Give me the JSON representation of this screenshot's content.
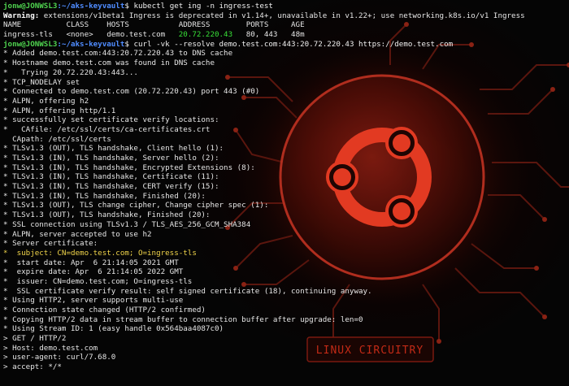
{
  "background": {
    "badge_text": "LINUX CIRCUITRY",
    "accent_color": "#ff3b1f"
  },
  "lines": [
    {
      "prompt": {
        "user": "jonw@JONWSL3",
        "path": ":~/aks-keyvault",
        "sym": "$ "
      },
      "text": "kubectl get ing -n ingress-test"
    },
    {
      "warn": "Warning:",
      "text": " extensions/v1beta1 Ingress is deprecated in v1.14+, unavailable in v1.22+; use networking.k8s.io/v1 Ingress"
    },
    {
      "text": "NAME          CLASS    HOSTS           ADDRESS        PORTS     AGE"
    },
    {
      "text": "ingress-tls   <none>   demo.test.com   ",
      "hl": "20.72.220.43",
      "rest": "   80, 443   48m"
    },
    {
      "prompt": {
        "user": "jonw@JONWSL3",
        "path": ":~/aks-keyvault",
        "sym": "$ "
      },
      "text": "curl -vk --resolve demo.test.com:443:20.72.220.43 https://demo.test.com"
    },
    {
      "text": "* Added demo.test.com:443:20.72.220.43 to DNS cache"
    },
    {
      "text": "* Hostname demo.test.com was found in DNS cache"
    },
    {
      "text": "*   Trying 20.72.220.43:443..."
    },
    {
      "text": "* TCP_NODELAY set"
    },
    {
      "text": "* Connected to demo.test.com (20.72.220.43) port 443 (#0)"
    },
    {
      "text": "* ALPN, offering h2"
    },
    {
      "text": "* ALPN, offering http/1.1"
    },
    {
      "text": "* successfully set certificate verify locations:"
    },
    {
      "text": "*   CAfile: /etc/ssl/certs/ca-certificates.crt"
    },
    {
      "text": "  CApath: /etc/ssl/certs"
    },
    {
      "text": "* TLSv1.3 (OUT), TLS handshake, Client hello (1):"
    },
    {
      "text": "* TLSv1.3 (IN), TLS handshake, Server hello (2):"
    },
    {
      "text": "* TLSv1.3 (IN), TLS handshake, Encrypted Extensions (8):"
    },
    {
      "text": "* TLSv1.3 (IN), TLS handshake, Certificate (11):"
    },
    {
      "text": "* TLSv1.3 (IN), TLS handshake, CERT verify (15):"
    },
    {
      "text": "* TLSv1.3 (IN), TLS handshake, Finished (20):"
    },
    {
      "text": "* TLSv1.3 (OUT), TLS change cipher, Change cipher spec (1):"
    },
    {
      "text": "* TLSv1.3 (OUT), TLS handshake, Finished (20):"
    },
    {
      "text": "* SSL connection using TLSv1.3 / TLS_AES_256_GCM_SHA384"
    },
    {
      "text": "* ALPN, server accepted to use h2"
    },
    {
      "text": "* Server certificate:"
    },
    {
      "text": "*  subject: CN=demo.test.com; O=ingress-tls",
      "color": "yellow"
    },
    {
      "text": "*  start date: Apr  6 21:14:05 2021 GMT"
    },
    {
      "text": "*  expire date: Apr  6 21:14:05 2022 GMT"
    },
    {
      "text": "*  issuer: CN=demo.test.com; O=ingress-tls"
    },
    {
      "text": "*  SSL certificate verify result: self signed certificate (18), continuing anyway."
    },
    {
      "text": "* Using HTTP2, server supports multi-use"
    },
    {
      "text": "* Connection state changed (HTTP/2 confirmed)"
    },
    {
      "text": "* Copying HTTP/2 data in stream buffer to connection buffer after upgrade: len=0"
    },
    {
      "text": "* Using Stream ID: 1 (easy handle 0x564baa4087c0)"
    },
    {
      "text": "> GET / HTTP/2"
    },
    {
      "text": "> Host: demo.test.com"
    },
    {
      "text": "> user-agent: curl/7.68.0"
    },
    {
      "text": "> accept: */*"
    }
  ]
}
